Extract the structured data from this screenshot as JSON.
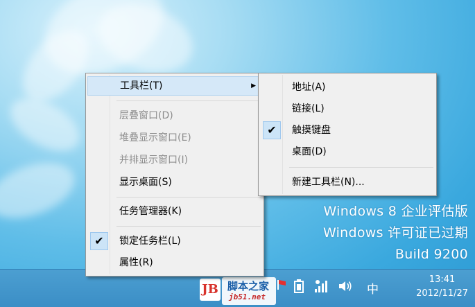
{
  "watermark": {
    "line1": "Windows 8 企业评估版",
    "line2": "Windows 许可证已过期",
    "line3": "Build 9200"
  },
  "context_menu": {
    "items": [
      {
        "label": "工具栏(T)",
        "submenu_arrow": "▶"
      },
      {
        "label": "层叠窗口(D)"
      },
      {
        "label": "堆叠显示窗口(E)"
      },
      {
        "label": "并排显示窗口(I)"
      },
      {
        "label": "显示桌面(S)"
      },
      {
        "label": "任务管理器(K)"
      },
      {
        "label": "锁定任务栏(L)",
        "checked": true
      },
      {
        "label": "属性(R)"
      }
    ]
  },
  "toolbar_submenu": {
    "items": [
      {
        "label": "地址(A)"
      },
      {
        "label": "链接(L)"
      },
      {
        "label": "触摸键盘",
        "checked": true
      },
      {
        "label": "桌面(D)"
      },
      {
        "label": "新建工具栏(N)..."
      }
    ]
  },
  "check_glyph": "✔",
  "taskbar": {
    "ime": "中",
    "time": "13:41",
    "date": "2012/11/27"
  },
  "logo": {
    "mark": "JB",
    "title": "脚本之家",
    "url": "jb51.net"
  },
  "colors": {
    "menu_bg": "#f0f0f0",
    "hover": "#d5e8f8",
    "check_bg": "#cce4f7",
    "taskbar": "#3b8ec6"
  }
}
